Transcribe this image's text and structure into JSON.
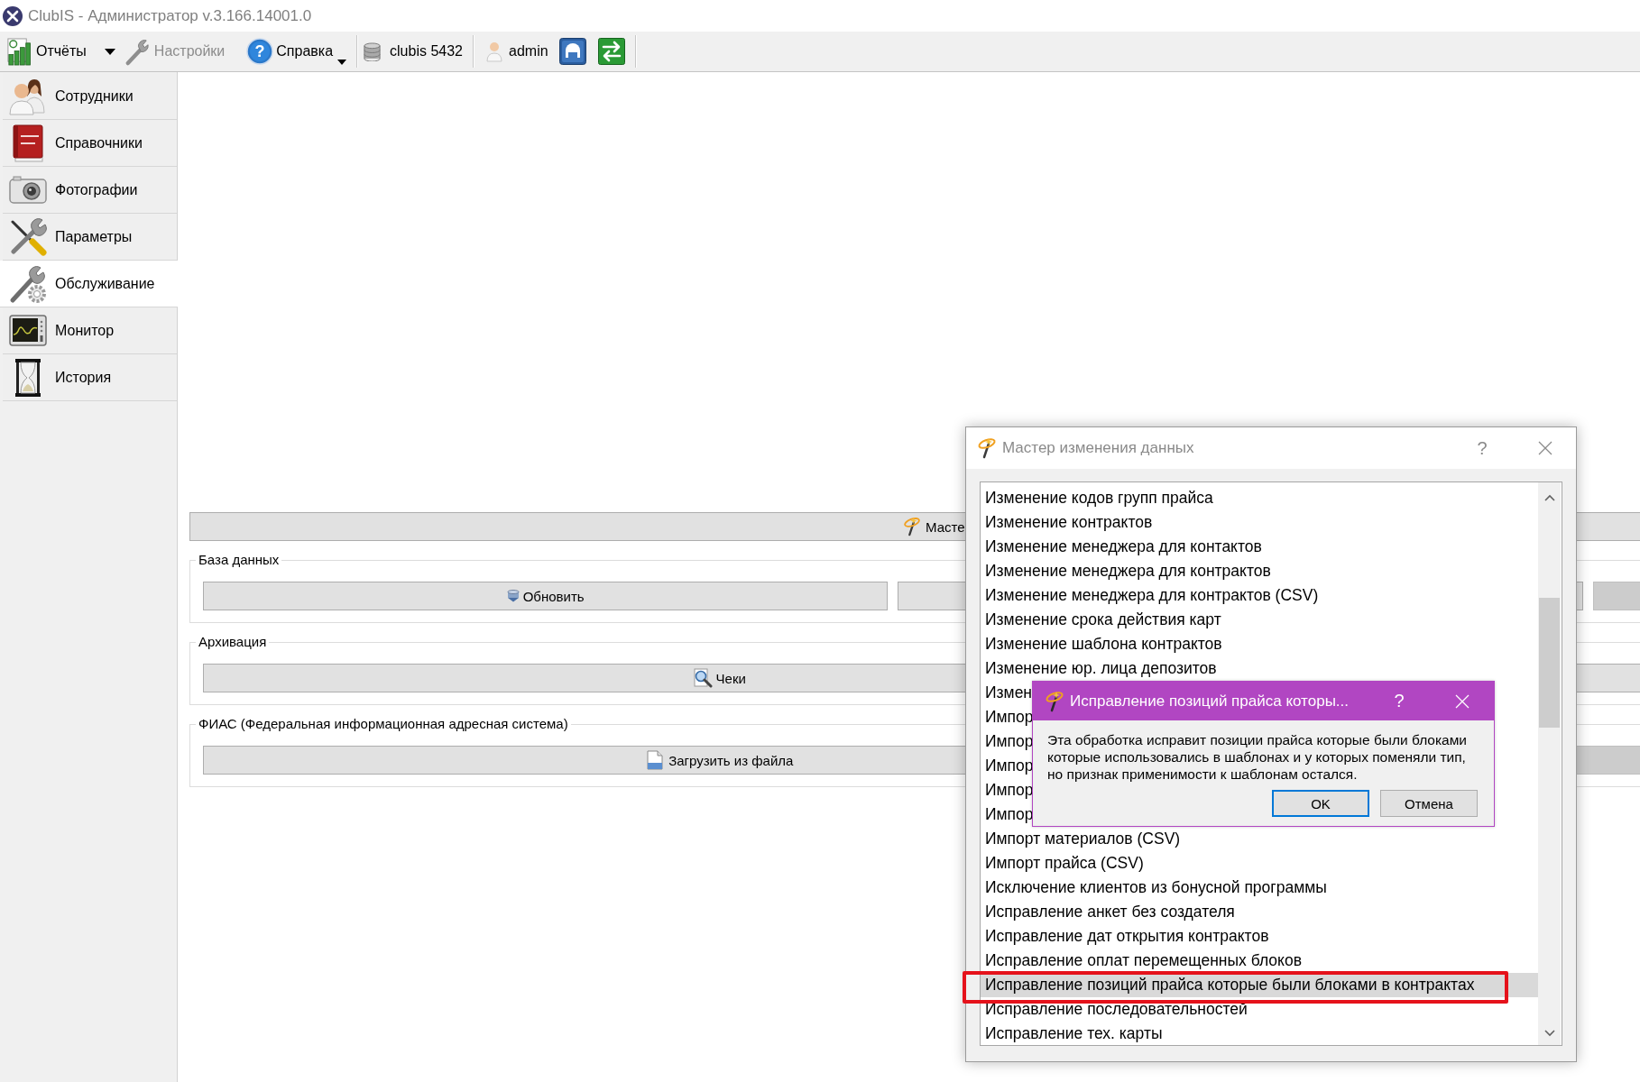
{
  "window": {
    "title": "ClubIS - Администратор v.3.166.14001.0"
  },
  "toolbar": {
    "reports": {
      "label": "Отчёты",
      "disabled": false,
      "has_menu": true
    },
    "settings": {
      "label": "Настройки",
      "disabled": true
    },
    "help": {
      "label": "Справка",
      "glyph": "?",
      "disabled": false,
      "has_menu": true
    },
    "connection": {
      "label": "clubis 5432"
    },
    "user": {
      "label": "admin"
    }
  },
  "sidebar": {
    "items": [
      {
        "label": "Сотрудники",
        "selected": false
      },
      {
        "label": "Справочники",
        "selected": false
      },
      {
        "label": "Фотографии",
        "selected": false
      },
      {
        "label": "Параметры",
        "selected": false
      },
      {
        "label": "Обслуживание",
        "selected": true
      },
      {
        "label": "Монитор",
        "selected": false
      },
      {
        "label": "История",
        "selected": false
      }
    ]
  },
  "main": {
    "wizard_button": {
      "label": "Масте"
    },
    "groups": [
      {
        "title": "База данных",
        "buttons": [
          {
            "label": "Обновить",
            "disabled": false
          },
          {
            "disabled": false
          },
          {
            "disabled": true
          }
        ]
      },
      {
        "title": "Архивация",
        "buttons": [
          {
            "label": "Чеки",
            "disabled": false
          },
          {
            "disabled": false
          }
        ]
      },
      {
        "title": "ФИАС (Федеральная информационная адресная система)",
        "buttons": [
          {
            "label": "Загрузить из файла",
            "disabled": false
          },
          {
            "disabled": true
          }
        ]
      }
    ]
  },
  "wizard_dialog": {
    "title": "Мастер изменения данных",
    "help": "?",
    "items": [
      {
        "label": "Изменение кодов групп прайса",
        "selected": false
      },
      {
        "label": "Изменение контрактов",
        "selected": false
      },
      {
        "label": "Изменение менеджера для контактов",
        "selected": false
      },
      {
        "label": "Изменение менеджера для контрактов",
        "selected": false
      },
      {
        "label": "Изменение менеджера для контрактов (CSV)",
        "selected": false
      },
      {
        "label": "Изменение срока действия карт",
        "selected": false
      },
      {
        "label": "Изменение шаблона контрактов",
        "selected": false
      },
      {
        "label": "Изменение юр. лица депозитов",
        "selected": false
      },
      {
        "label": "Измен",
        "selected": false
      },
      {
        "label": "Импор",
        "selected": false
      },
      {
        "label": "Импор",
        "selected": false
      },
      {
        "label": "Импор",
        "selected": false
      },
      {
        "label": "Импор",
        "selected": false
      },
      {
        "label": "Импор",
        "selected": false
      },
      {
        "label": "Импорт материалов (CSV)",
        "selected": false
      },
      {
        "label": "Импорт прайса (CSV)",
        "selected": false
      },
      {
        "label": "Исключение клиентов из бонусной программы",
        "selected": false
      },
      {
        "label": "Исправление анкет без создателя",
        "selected": false
      },
      {
        "label": "Исправление дат открытия контрактов",
        "selected": false
      },
      {
        "label": "Исправление оплат перемещенных блоков",
        "selected": false
      },
      {
        "label": "Исправление позиций прайса которые были блоками в контрактах",
        "selected": true
      },
      {
        "label": "Исправление последовательностей",
        "selected": false
      },
      {
        "label": "Исправление тех. карты",
        "selected": false
      }
    ]
  },
  "confirm_dialog": {
    "title": "Исправление позиций прайса которы...",
    "help": "?",
    "message": "Эта обработка исправит позиции прайса которые были блоками которые использовались в шаблонах и у которых поменяли тип, но признак применимости к шаблонам остался.",
    "buttons": [
      {
        "label": "OK",
        "default": true
      },
      {
        "label": "Отмена",
        "default": false
      }
    ]
  }
}
